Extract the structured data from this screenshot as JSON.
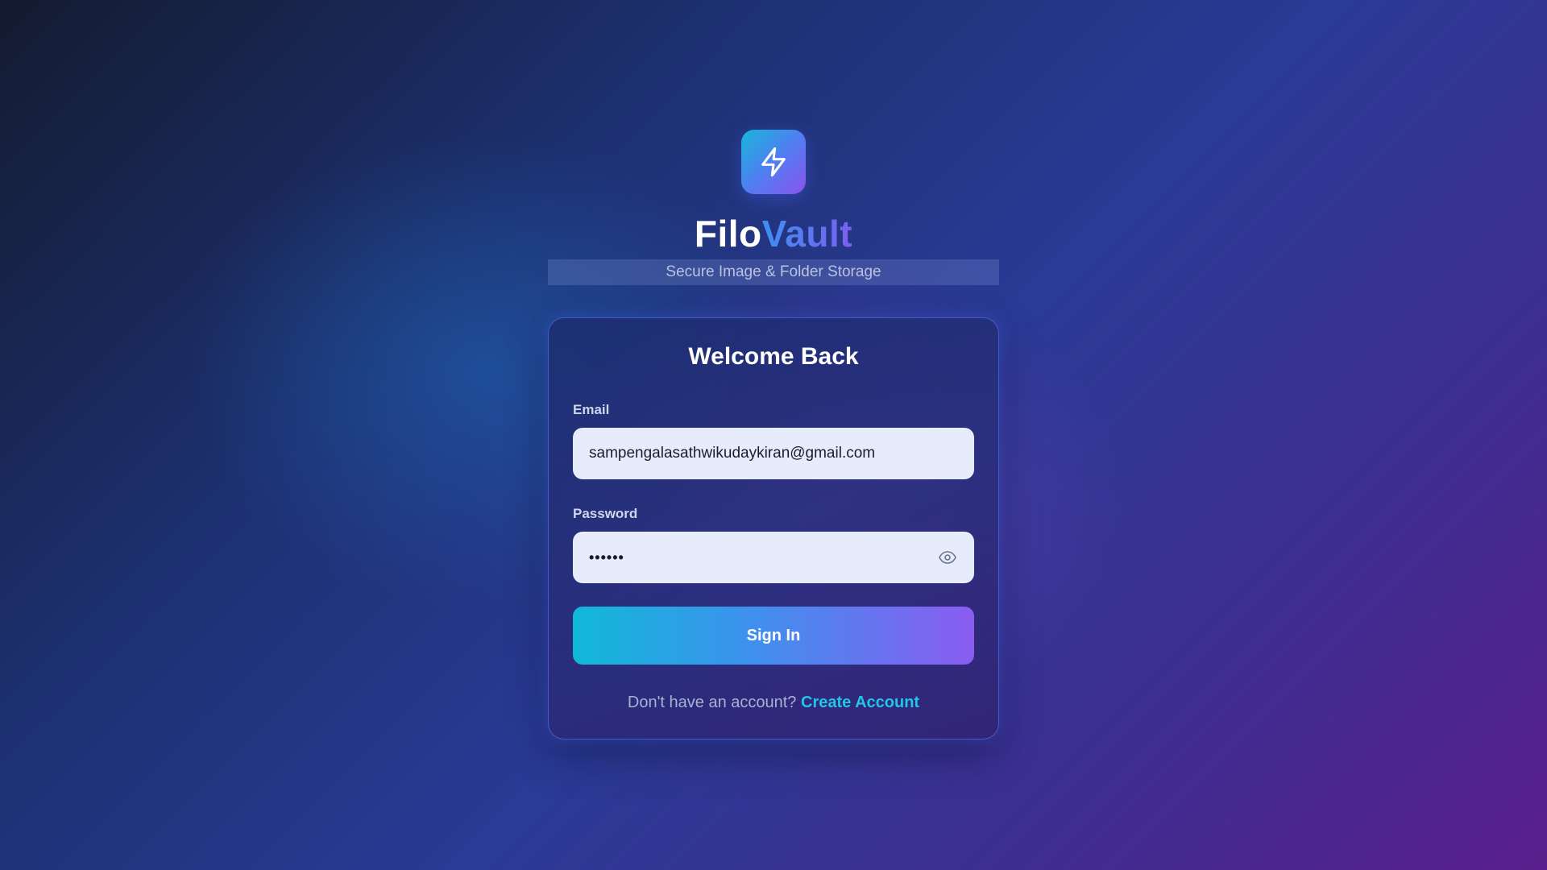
{
  "app": {
    "logo_icon": "lightning-bolt-icon",
    "brand_part1": "Filo",
    "brand_part2": "Vault",
    "tagline": "Secure Image & Folder Storage"
  },
  "login": {
    "title": "Welcome Back",
    "email_label": "Email",
    "email_value": "sampengalasathwikudaykiran@gmail.com",
    "password_label": "Password",
    "password_value": "••••••",
    "password_toggle_icon": "eye-icon",
    "submit_label": "Sign In",
    "footer_text": "Don't have an account?",
    "footer_link": "Create Account"
  },
  "colors": {
    "accent_cyan": "#22c4e8",
    "accent_purple": "#8a5cf0",
    "input_background": "#e6ecfa"
  }
}
